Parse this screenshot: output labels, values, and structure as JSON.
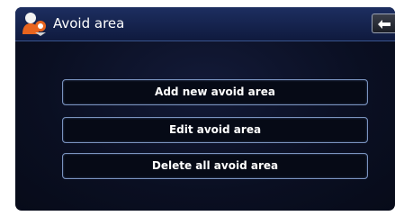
{
  "header": {
    "title": "Avoid area",
    "title_icon": "avoid-area-person-icon",
    "back_icon": "back-arrow-icon"
  },
  "menu": {
    "items": [
      {
        "label": "Add new avoid area"
      },
      {
        "label": "Edit avoid area"
      },
      {
        "label": "Delete all avoid area"
      }
    ]
  },
  "colors": {
    "background": "#0a0f22",
    "title_bar": "#1d2e60",
    "button_border": "#7a93bf",
    "icon_accent": "#e8641e",
    "text": "#ffffff"
  }
}
